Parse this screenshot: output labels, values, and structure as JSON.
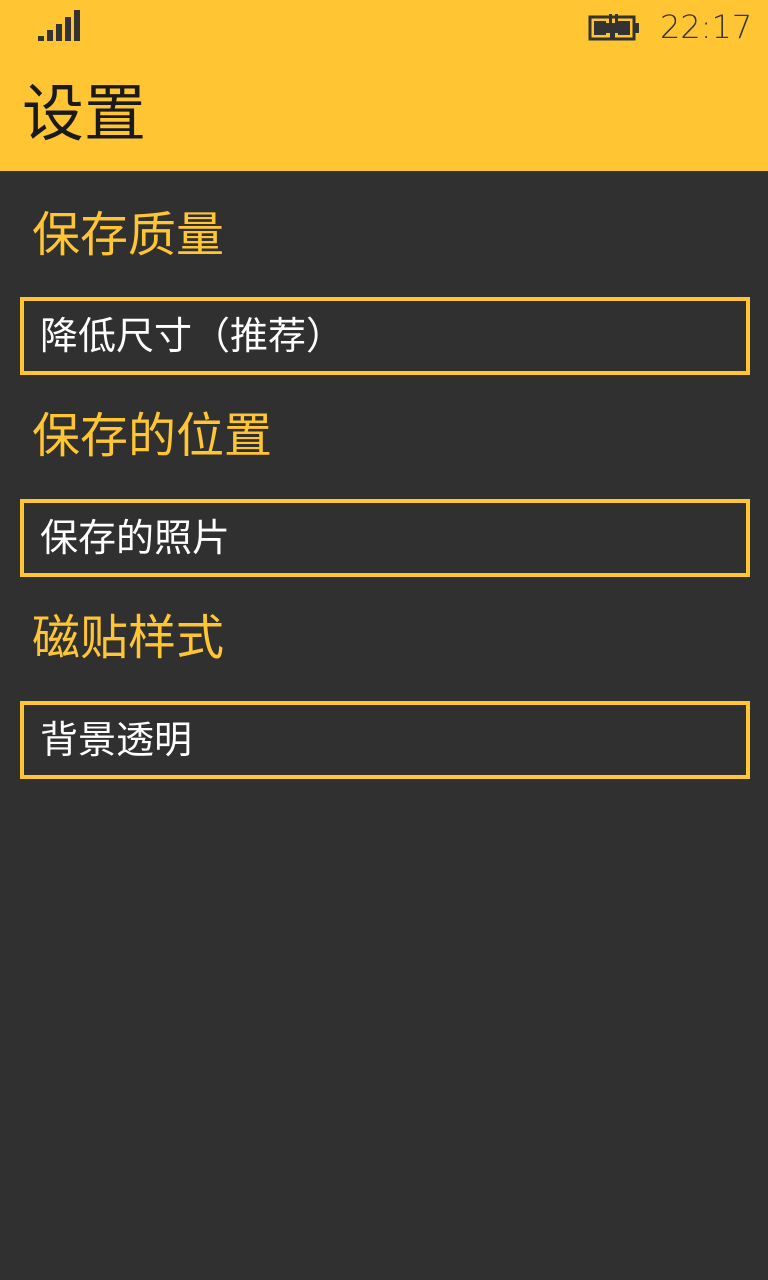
{
  "status_bar": {
    "signal_icon": "signal-strength-icon",
    "battery_icon": "battery-charging-icon",
    "time": "22:17"
  },
  "header": {
    "title": "设置",
    "background_color": "#FFC533"
  },
  "sections": [
    {
      "heading": "保存质量",
      "value": "降低尺寸（推荐）"
    },
    {
      "heading": "保存的位置",
      "value": "保存的照片"
    },
    {
      "heading": "磁贴样式",
      "value": "背景透明"
    }
  ],
  "colors": {
    "accent": "#FFC533",
    "background": "#303030",
    "text": "#FFFFFF"
  }
}
